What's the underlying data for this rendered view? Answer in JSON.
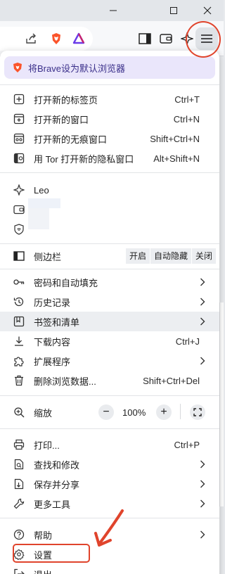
{
  "banner": {
    "text": "将Brave设为默认浏览器"
  },
  "new_tab": {
    "label": "打开新的标签页",
    "shortcut": "Ctrl+T"
  },
  "new_window": {
    "label": "打开新的窗口",
    "shortcut": "Ctrl+N"
  },
  "new_private": {
    "label": "打开新的无痕窗口",
    "shortcut": "Shift+Ctrl+N"
  },
  "new_tor": {
    "label": "用 Tor 打开新的隐私窗口",
    "shortcut": "Alt+Shift+N"
  },
  "leo": {
    "label": "Leo"
  },
  "sidebar": {
    "label": "侧边栏",
    "options": [
      "开启",
      "自动隐藏",
      "关闭"
    ]
  },
  "passwords": {
    "label": "密码和自动填充"
  },
  "history": {
    "label": "历史记录"
  },
  "bookmarks": {
    "label": "书签和清单"
  },
  "downloads": {
    "label": "下载内容",
    "shortcut": "Ctrl+J"
  },
  "extensions": {
    "label": "扩展程序"
  },
  "clear_data": {
    "label": "删除浏览数据...",
    "shortcut": "Shift+Ctrl+Del"
  },
  "zoom": {
    "label": "缩放",
    "minus": "−",
    "value": "100%",
    "plus": "+"
  },
  "print": {
    "label": "打印...",
    "shortcut": "Ctrl+P"
  },
  "find": {
    "label": "查找和修改"
  },
  "save_share": {
    "label": "保存并分享"
  },
  "more_tools": {
    "label": "更多工具"
  },
  "help": {
    "label": "帮助"
  },
  "settings": {
    "label": "设置"
  },
  "exit": {
    "label": "退出"
  },
  "colors": {
    "annotation": "#e0442c",
    "banner_bg": "#eae6fb",
    "brave_orange": "#fb542b"
  }
}
